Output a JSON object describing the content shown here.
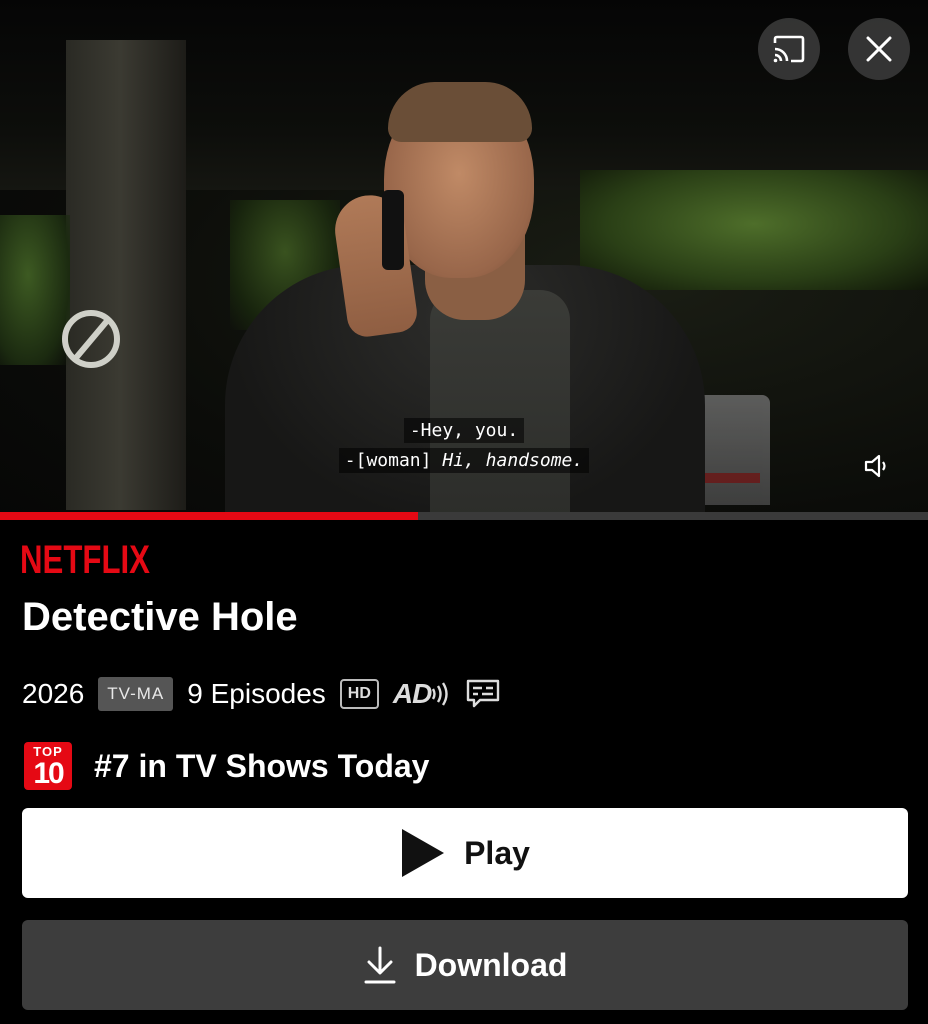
{
  "video": {
    "subtitle_line1": "-Hey, you.",
    "subtitle_line2_prefix": "-[woman]",
    "subtitle_line2_italic": "Hi, handsome.",
    "progress": 0.45
  },
  "controls": {
    "cast_icon": "cast-icon",
    "close_icon": "close-icon",
    "volume_icon": "volume-icon"
  },
  "brand": "NETFLIX",
  "title": "Detective Hole",
  "meta": {
    "year": "2026",
    "rating": "TV-MA",
    "episodes": "9 Episodes",
    "quality": "HD",
    "audio_description": "AD"
  },
  "rank": {
    "badge_top": "TOP",
    "badge_num": "10",
    "text": "#7 in TV Shows Today"
  },
  "actions": {
    "play_label": "Play",
    "download_label": "Download"
  },
  "colors": {
    "accent": "#e50914",
    "background": "#000000",
    "download_bg": "#3d3d3d"
  }
}
